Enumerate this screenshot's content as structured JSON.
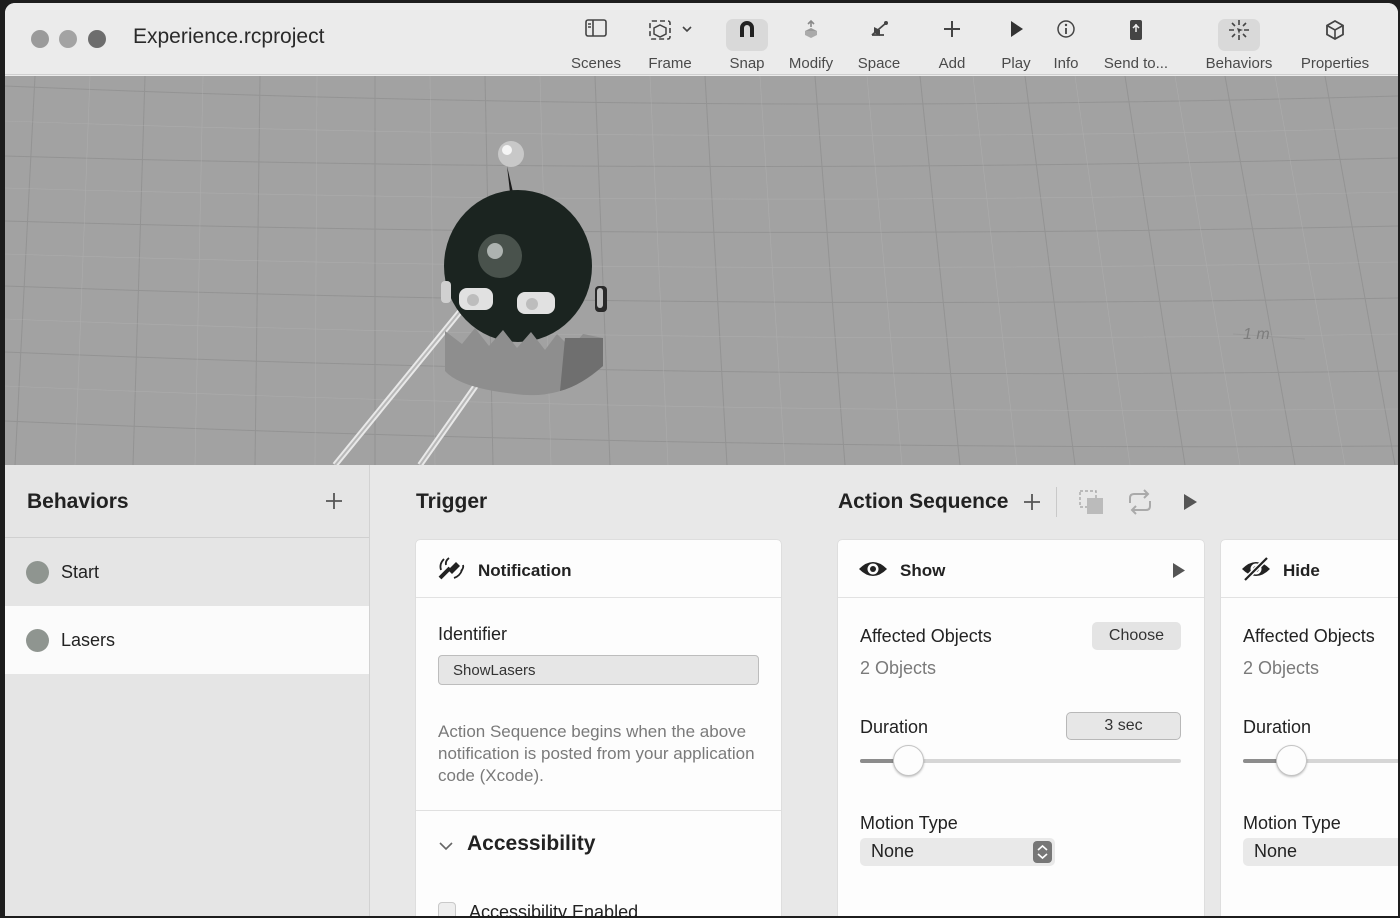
{
  "window": {
    "title": "Experience.rcproject"
  },
  "toolbar": {
    "scenes": "Scenes",
    "frame": "Frame",
    "snap": "Snap",
    "modify": "Modify",
    "space": "Space",
    "add": "Add",
    "play": "Play",
    "info": "Info",
    "send_to": "Send to...",
    "behaviors": "Behaviors",
    "properties": "Properties"
  },
  "viewport": {
    "scale_label": "1 m"
  },
  "behaviors_panel": {
    "title": "Behaviors",
    "items": [
      {
        "label": "Start"
      },
      {
        "label": "Lasers",
        "selected": true
      }
    ]
  },
  "trigger": {
    "section_title": "Trigger",
    "card_title": "Notification",
    "identifier_label": "Identifier",
    "identifier_value": "ShowLasers",
    "description": "Action Sequence begins when the above notification is posted from your application code (Xcode).",
    "accessibility_title": "Accessibility",
    "accessibility_enabled_label": "Accessibility Enabled"
  },
  "action_sequence": {
    "section_title": "Action Sequence",
    "actions": [
      {
        "title": "Show",
        "affected_objects_label": "Affected Objects",
        "choose_label": "Choose",
        "objects_count": "2 Objects",
        "duration_label": "Duration",
        "duration_value": "3 sec",
        "duration_fraction": 0.1,
        "motion_type_label": "Motion Type",
        "motion_type_value": "None"
      },
      {
        "title": "Hide",
        "affected_objects_label": "Affected Objects",
        "objects_count": "2 Objects",
        "duration_label": "Duration",
        "duration_fraction": 0.1,
        "motion_type_label": "Motion Type",
        "motion_type_value": "None"
      }
    ]
  },
  "colors": {
    "window_bg": "#ececec",
    "viewport_bg": "#a2a2a2",
    "selected_row": "#fbfbfb",
    "behavior_dot": "#8f9590"
  }
}
